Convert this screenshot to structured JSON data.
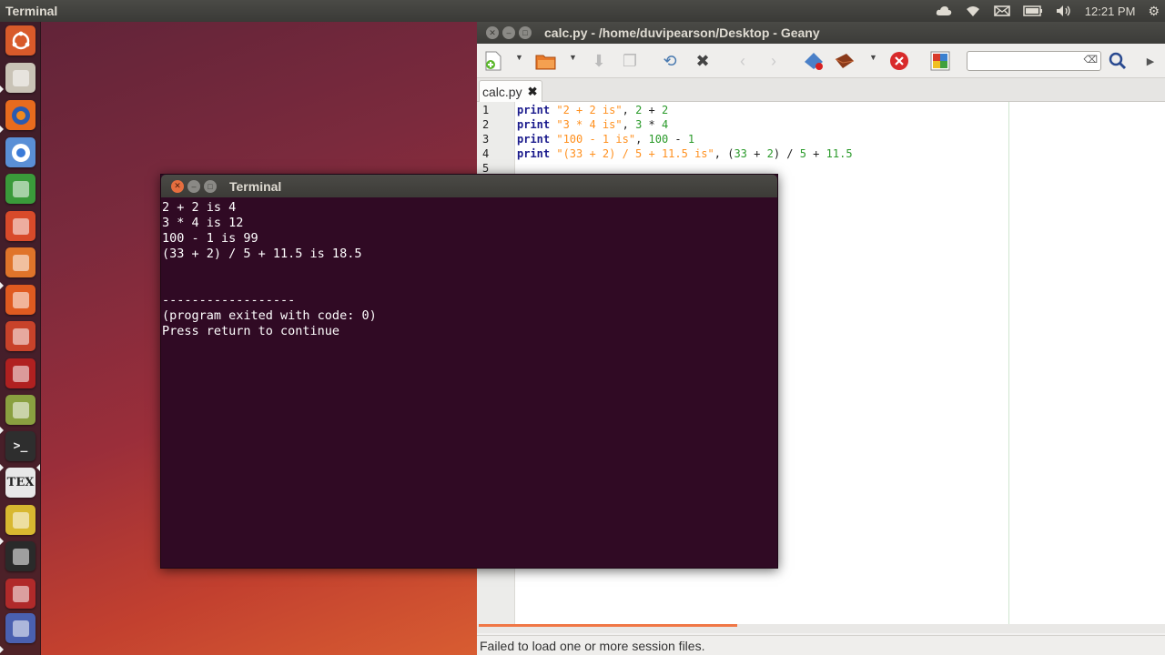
{
  "top_panel": {
    "app_title": "Terminal",
    "clock": "12:21 PM",
    "indicators": [
      "cloud-icon",
      "wifi-icon",
      "mail-icon",
      "battery-icon",
      "volume-icon",
      "gear-icon"
    ]
  },
  "launcher": {
    "items": [
      {
        "name": "dash-home",
        "color": "#d85a2a"
      },
      {
        "name": "files",
        "color": "#c9c3b6"
      },
      {
        "name": "firefox",
        "color": "#e86b1e"
      },
      {
        "name": "chromium",
        "color": "#5a8fd6"
      },
      {
        "name": "libreoffice-calc",
        "color": "#3a9a3a"
      },
      {
        "name": "libreoffice-impress",
        "color": "#d84a2a"
      },
      {
        "name": "ubuntu-software-center",
        "color": "#e0742a"
      },
      {
        "name": "ubuntu-one",
        "color": "#e05a20"
      },
      {
        "name": "system-settings",
        "color": "#c8422a"
      },
      {
        "name": "cherrytree",
        "color": "#b02020"
      },
      {
        "name": "archive-manager",
        "color": "#8aa040"
      },
      {
        "name": "terminal",
        "color": "#2e2e2e"
      },
      {
        "name": "texmaker",
        "color": "#e8e8e8"
      },
      {
        "name": "geany",
        "color": "#d8b830"
      },
      {
        "name": "system-monitor",
        "color": "#2a2a2a"
      },
      {
        "name": "scribus",
        "color": "#b02a2a"
      },
      {
        "name": "trash",
        "color": "#4a60b0"
      }
    ],
    "texmaker_label": "TEX"
  },
  "geany": {
    "title": "calc.py - /home/duvipearson/Desktop - Geany",
    "tab_label": "calc.py",
    "line_numbers": [
      "1",
      "2",
      "3",
      "4",
      "5"
    ],
    "code": [
      {
        "kw": "print",
        "str": "\"2 + 2 is\"",
        "rest": ", 2 + 2"
      },
      {
        "kw": "print",
        "str": "\"3 * 4 is\"",
        "rest": ", 3 * 4"
      },
      {
        "kw": "print",
        "str": "\"100 - 1 is\"",
        "rest": ", 100 - 1"
      },
      {
        "kw": "print",
        "str": "\"(33 + 2) / 5 + 11.5 is\"",
        "rest": ", (33 + 2) / 5 + 11.5"
      }
    ],
    "status": "Failed to load one or more session files.",
    "search_value": ""
  },
  "terminal": {
    "title": "Terminal",
    "lines": [
      "2 + 2 is 4",
      "3 * 4 is 12",
      "100 - 1 is 99",
      "(33 + 2) / 5 + 11.5 is 18.5",
      "",
      "",
      "------------------",
      "(program exited with code: 0)",
      "Press return to continue"
    ]
  }
}
